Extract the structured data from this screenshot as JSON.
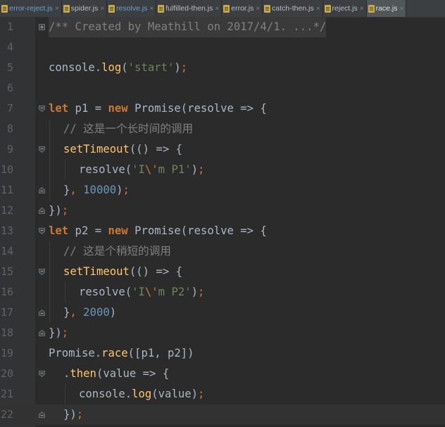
{
  "tabs": [
    {
      "label": "error-reject.js",
      "blue": true
    },
    {
      "label": "spider.js",
      "blue": false
    },
    {
      "label": "resolve.js",
      "blue": true
    },
    {
      "label": "fulfilled-then.js",
      "blue": false
    },
    {
      "label": "error.js",
      "blue": false
    },
    {
      "label": "catch-then.js",
      "blue": false
    },
    {
      "label": "reject.js",
      "blue": false
    },
    {
      "label": "race.js",
      "blue": false,
      "active": true
    }
  ],
  "tab_close_glyph": "×",
  "lines": [
    {
      "n": "1"
    },
    {
      "n": "4"
    },
    {
      "n": "5"
    },
    {
      "n": "6"
    },
    {
      "n": "7"
    },
    {
      "n": "8"
    },
    {
      "n": "9"
    },
    {
      "n": "10"
    },
    {
      "n": "11"
    },
    {
      "n": "12"
    },
    {
      "n": "13"
    },
    {
      "n": "14"
    },
    {
      "n": "15"
    },
    {
      "n": "16"
    },
    {
      "n": "17"
    },
    {
      "n": "18"
    },
    {
      "n": "19"
    },
    {
      "n": "20"
    },
    {
      "n": "21"
    },
    {
      "n": "22"
    }
  ],
  "code": {
    "l1": "/** Created by Meathill on 2017/4/1. ...*/",
    "console": "console",
    "dot": ".",
    "log": "log",
    "open_paren": "(",
    "close_paren": ")",
    "semi": ";",
    "start_str": "'start'",
    "let": "let",
    "p1": " p1 = ",
    "p2": " p2 = ",
    "new": "new",
    "promise_resolve": " Promise(resolve => {",
    "comment_long": "// 这是一个长时间的调用",
    "comment_short": "// 这是个稍短的调用",
    "setTimeout": "setTimeout",
    "arrow_open": "(() => {",
    "resolve": "resolve(",
    "str_q": "'I",
    "esc": "\\'",
    "p1_tail": "m P1'",
    "p2_tail": "m P2'",
    "close_call": ");",
    "brace_close": "}",
    "comma": ",",
    "num_10000": "10000",
    "num_2000": "2000",
    "close_paren_semi": ");",
    "close_paren_only": ")",
    "block_end": "});",
    "promise": "Promise",
    "race": "race",
    "race_args": "([p1, p2])",
    "then": "then",
    "then_args": "(value => {",
    "value_arg": "(value)",
    "end": "});"
  }
}
